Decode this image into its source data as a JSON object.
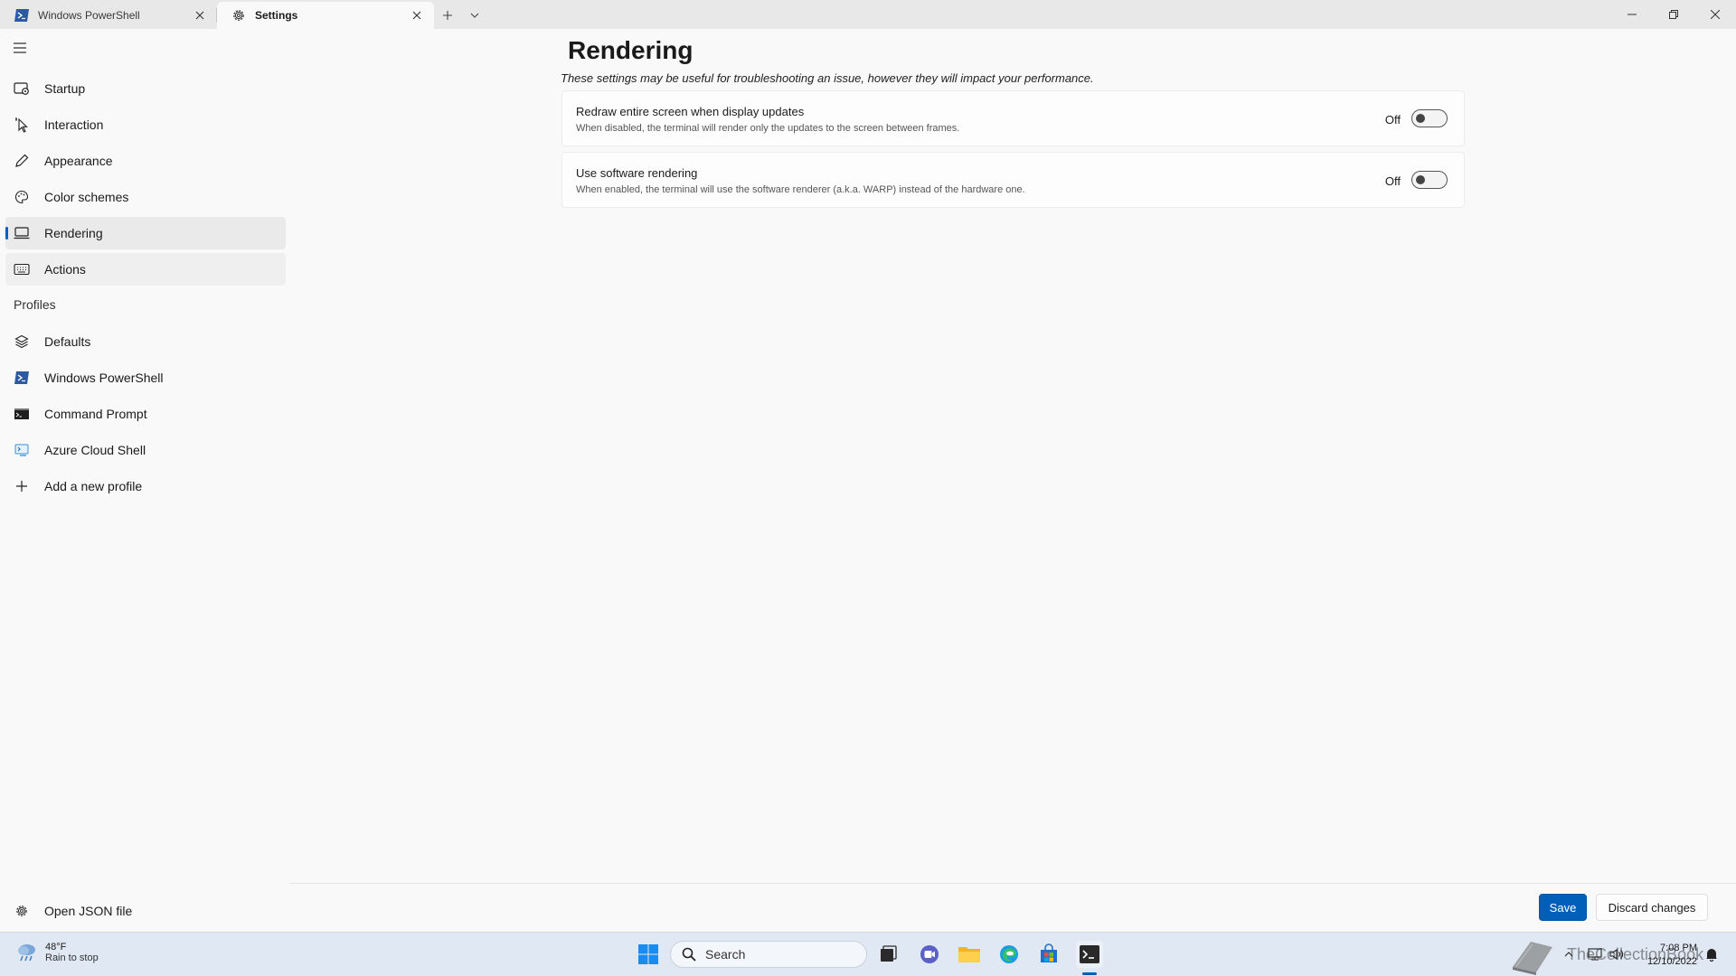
{
  "tabs": [
    {
      "label": "Windows PowerShell",
      "icon": "powershell-icon",
      "active": false
    },
    {
      "label": "Settings",
      "icon": "gear-icon",
      "active": true
    }
  ],
  "sidebar": {
    "items": [
      {
        "label": "Startup",
        "icon": "startup-icon"
      },
      {
        "label": "Interaction",
        "icon": "cursor-icon"
      },
      {
        "label": "Appearance",
        "icon": "pen-icon"
      },
      {
        "label": "Color schemes",
        "icon": "palette-icon"
      },
      {
        "label": "Rendering",
        "icon": "monitor-icon",
        "selected": true
      },
      {
        "label": "Actions",
        "icon": "keyboard-icon"
      }
    ],
    "profiles_header": "Profiles",
    "profiles": [
      {
        "label": "Defaults",
        "icon": "layers-icon"
      },
      {
        "label": "Windows PowerShell",
        "icon": "powershell-icon"
      },
      {
        "label": "Command Prompt",
        "icon": "cmd-icon"
      },
      {
        "label": "Azure Cloud Shell",
        "icon": "azure-icon"
      },
      {
        "label": "Add a new profile",
        "icon": "plus-icon"
      }
    ],
    "open_json": "Open JSON file"
  },
  "main": {
    "title": "Rendering",
    "subtitle": "These settings may be useful for troubleshooting an issue, however they will impact your performance.",
    "settings": [
      {
        "title": "Redraw entire screen when display updates",
        "description": "When disabled, the terminal will render only the updates to the screen between frames.",
        "state": "Off"
      },
      {
        "title": "Use software rendering",
        "description": "When enabled, the terminal will use the software renderer (a.k.a. WARP) instead of the hardware one.",
        "state": "Off"
      }
    ]
  },
  "footer": {
    "save_label": "Save",
    "discard_label": "Discard changes"
  },
  "taskbar": {
    "weather_temp": "48°F",
    "weather_condition": "Rain to stop",
    "search_label": "Search",
    "time": "7:08 PM",
    "date": "12/10/2022",
    "watermark": "TheCollectionBook"
  },
  "colors": {
    "accent": "#005fb8",
    "background": "#f9f9f9",
    "taskbar": "#dfe8f3"
  }
}
